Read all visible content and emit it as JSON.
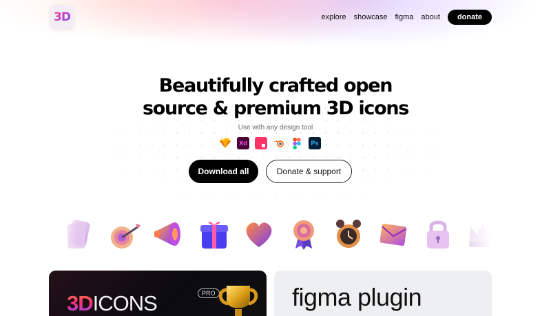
{
  "header": {
    "logo_text": "3D",
    "nav": [
      "explore",
      "showcase",
      "figma",
      "about"
    ],
    "donate_label": "donate"
  },
  "hero": {
    "title_line1": "Beautifully crafted open",
    "title_line2": "source & premium 3D icons",
    "subtitle": "Use with any design tool",
    "tools": [
      "sketch-icon",
      "adobe-xd-icon",
      "invision-icon",
      "blender-icon",
      "figma-icon",
      "photoshop-icon"
    ],
    "tool_labels": {
      "xd": "Xd",
      "ps": "Ps"
    },
    "primary_button": "Download all",
    "secondary_button": "Donate & support"
  },
  "carousel": [
    "notebook-icon",
    "target-dart-icon",
    "megaphone-icon",
    "gift-box-icon",
    "heart-icon",
    "medal-icon",
    "alarm-clock-icon",
    "envelope-icon",
    "padlock-icon",
    "crown-icon"
  ],
  "cards": {
    "dark": {
      "brand_3d": "3D",
      "brand_icons": "ICONS",
      "badge": "PRO"
    },
    "light": {
      "title": "figma plugin"
    }
  },
  "colors": {
    "accent": "#000000",
    "card_dark": "#0b0b0f",
    "card_light": "#eeeff1"
  }
}
